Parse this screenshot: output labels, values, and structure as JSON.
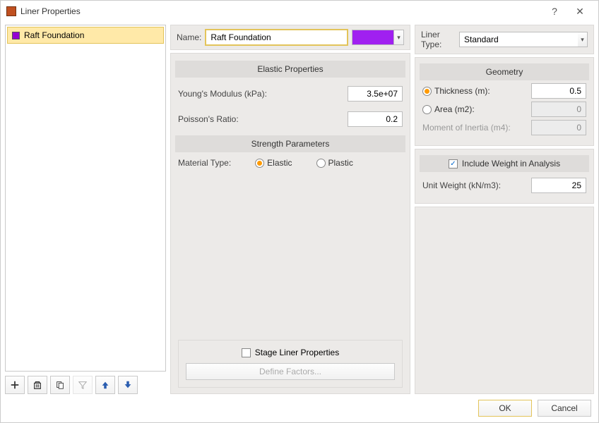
{
  "window": {
    "title": "Liner Properties"
  },
  "list": {
    "items": [
      {
        "name": "Raft Foundation",
        "color": "#9400d3"
      }
    ]
  },
  "name_row": {
    "label": "Name:",
    "value": "Raft Foundation",
    "color": "#a020f0"
  },
  "liner_type": {
    "label": "Liner Type:",
    "value": "Standard"
  },
  "elastic": {
    "header": "Elastic Properties",
    "youngs_label": "Young's Modulus (kPa):",
    "youngs_value": "3.5e+07",
    "poisson_label": "Poisson's Ratio:",
    "poisson_value": "0.2"
  },
  "strength": {
    "header": "Strength Parameters",
    "material_label": "Material Type:",
    "elastic_option": "Elastic",
    "plastic_option": "Plastic",
    "selected": "elastic"
  },
  "stage": {
    "checkbox_label": "Stage Liner Properties",
    "checked": false,
    "define_btn": "Define Factors..."
  },
  "geometry": {
    "header": "Geometry",
    "thickness_label": "Thickness (m):",
    "thickness_value": "0.5",
    "area_label": "Area (m2):",
    "area_value": "0",
    "moment_label": "Moment of Inertia (m4):",
    "moment_value": "0",
    "selected": "thickness"
  },
  "weight": {
    "include_label": "Include Weight in Analysis",
    "include_checked": true,
    "unit_label": "Unit Weight (kN/m3):",
    "unit_value": "25"
  },
  "footer": {
    "ok": "OK",
    "cancel": "Cancel"
  }
}
